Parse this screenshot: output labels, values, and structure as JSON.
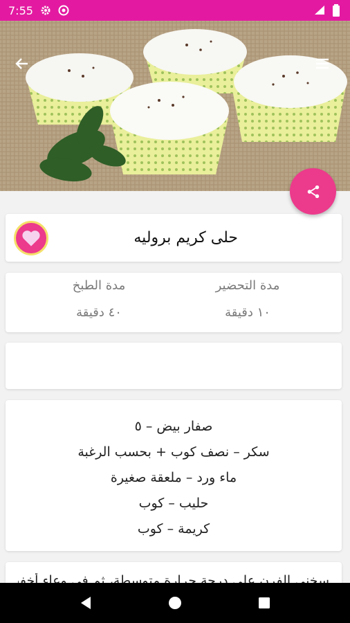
{
  "status_bar": {
    "time": "7:55",
    "color": "#e31aa1",
    "icons": [
      "settings-icon",
      "sync-icon",
      "wifi-icon",
      "battery-icon"
    ]
  },
  "toolbar": {
    "back_icon": "arrow-left-icon",
    "menu_icon": "hamburger-menu-icon"
  },
  "share_fab": {
    "icon": "share-icon",
    "color": "#ec3a8c"
  },
  "recipe": {
    "title": "حلى كريم بروليه",
    "favorite_icon": "heart-icon"
  },
  "times": {
    "prep_label": "مدة التحضير",
    "prep_value": "١٠ دقيقة",
    "cook_label": "مدة الطبخ",
    "cook_value": "٤٠ دقيقة"
  },
  "ingredients": [
    "صفار بيض – ٥",
    "سكر – نصف كوب + بحسب الرغبة",
    "ماء ورد – ملعقة صغيرة",
    "حليب – كوب",
    "كريمة – كوب"
  ],
  "steps": {
    "first_line": "سخني الفرن على درجة حرارة متوسطة، ثم في وعاء أخفقي صفار البيض"
  },
  "nav": {
    "back_icon": "nav-back-icon",
    "home_icon": "nav-home-icon",
    "recents_icon": "nav-recents-icon"
  }
}
